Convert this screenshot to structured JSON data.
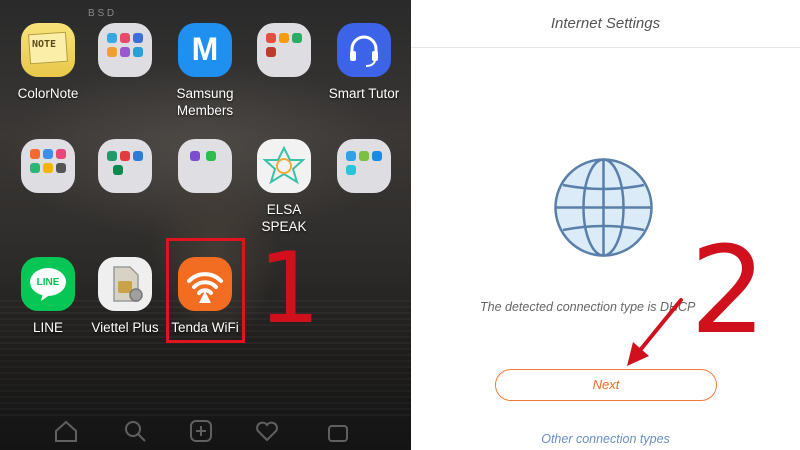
{
  "home_screen": {
    "status_text": "B S D",
    "apps": [
      {
        "label": "ColorNote",
        "icon": "colornote-icon"
      },
      {
        "label": "",
        "icon": "app-folder-icon"
      },
      {
        "label": "Samsung\nMembers",
        "icon": "samsung-members-icon"
      },
      {
        "label": "",
        "icon": "app-folder-icon"
      },
      {
        "label": "Smart Tutor",
        "icon": "headset-icon"
      },
      {
        "label": "",
        "icon": "app-folder-icon"
      },
      {
        "label": "",
        "icon": "app-folder-icon"
      },
      {
        "label": "",
        "icon": "app-folder-icon"
      },
      {
        "label": "ELSA\nSPEAK",
        "icon": "elsa-speak-icon"
      },
      {
        "label": "",
        "icon": "app-folder-icon"
      },
      {
        "label": "LINE",
        "icon": "line-icon"
      },
      {
        "label": "Viettel Plus",
        "icon": "sim-card-icon"
      },
      {
        "label": "Tenda WiFi",
        "icon": "wifi-icon"
      }
    ],
    "colornote_icon_text": "NOTE",
    "samsung_members_letter": "M",
    "line_icon_text": "LINE",
    "step_label": "1",
    "dock_icons": [
      "home-icon",
      "search-icon",
      "add-icon",
      "heart-icon",
      "bag-icon"
    ],
    "highlight_color": "#e0141e"
  },
  "router_app": {
    "title": "Internet Settings",
    "detected_text": "The detected connection type is DHCP",
    "next_label": "Next",
    "other_link": "Other connection types",
    "accent_color": "#ee6b25",
    "link_color": "#6a8fc8",
    "step_label": "2"
  }
}
